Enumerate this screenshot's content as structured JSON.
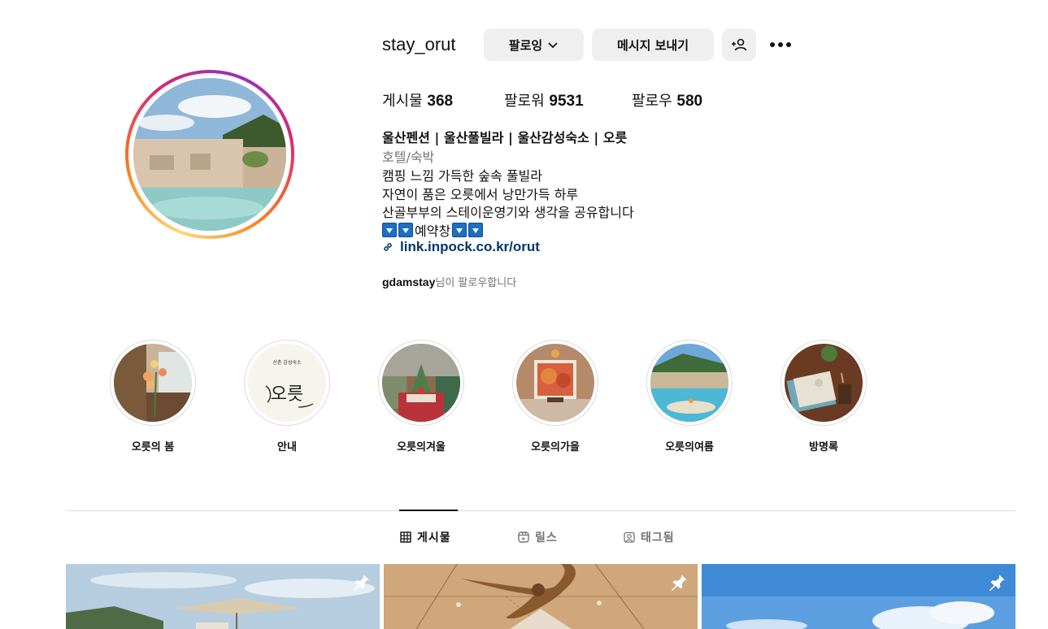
{
  "profile": {
    "username": "stay_orut",
    "follow_button": "팔로잉",
    "message_button": "메시지 보내기",
    "stats": {
      "posts_label": "게시물",
      "posts_count": "368",
      "followers_label": "팔로워",
      "followers_count": "9531",
      "following_label": "팔로우",
      "following_count": "580"
    },
    "bio": {
      "name": "울산펜션 |  울산풀빌라  |  울산감성숙소  |  오릇",
      "category": "호텔/숙박",
      "line1": "캠핑 느낌 가득한 숲속 풀빌라",
      "line2": "자연이 품은 오릇에서 낭만가득 하루",
      "line3": "산골부부의 스테이운영기와 생각을 공유합니다",
      "line4_text": "예약창",
      "link": "link.inpock.co.kr/orut"
    },
    "followed_by_name": "gdamstay",
    "followed_by_suffix": "님이 팔로우합니다"
  },
  "highlights": [
    {
      "label": "오릇의 봄"
    },
    {
      "label": "안내",
      "logo_small": "산촌 감성숙소",
      "logo_big": "오릇"
    },
    {
      "label": "오릇의겨울"
    },
    {
      "label": "오릇의가을"
    },
    {
      "label": "오릇의여름"
    },
    {
      "label": "방명록"
    }
  ],
  "tabs": [
    {
      "label": "게시물",
      "icon": "grid-icon",
      "active": true
    },
    {
      "label": "릴스",
      "icon": "reels-icon",
      "active": false
    },
    {
      "label": "태그됨",
      "icon": "tagged-icon",
      "active": false
    }
  ],
  "posts": [
    {
      "icon": "pin-icon",
      "pinned": true
    },
    {
      "icon": "pin-icon",
      "pinned": true
    },
    {
      "icon": "pin-icon",
      "pinned": true
    }
  ],
  "colors": {
    "link": "#00376b",
    "button_bg": "#efefef",
    "muted": "#737373",
    "story_ring": "#d62976"
  }
}
